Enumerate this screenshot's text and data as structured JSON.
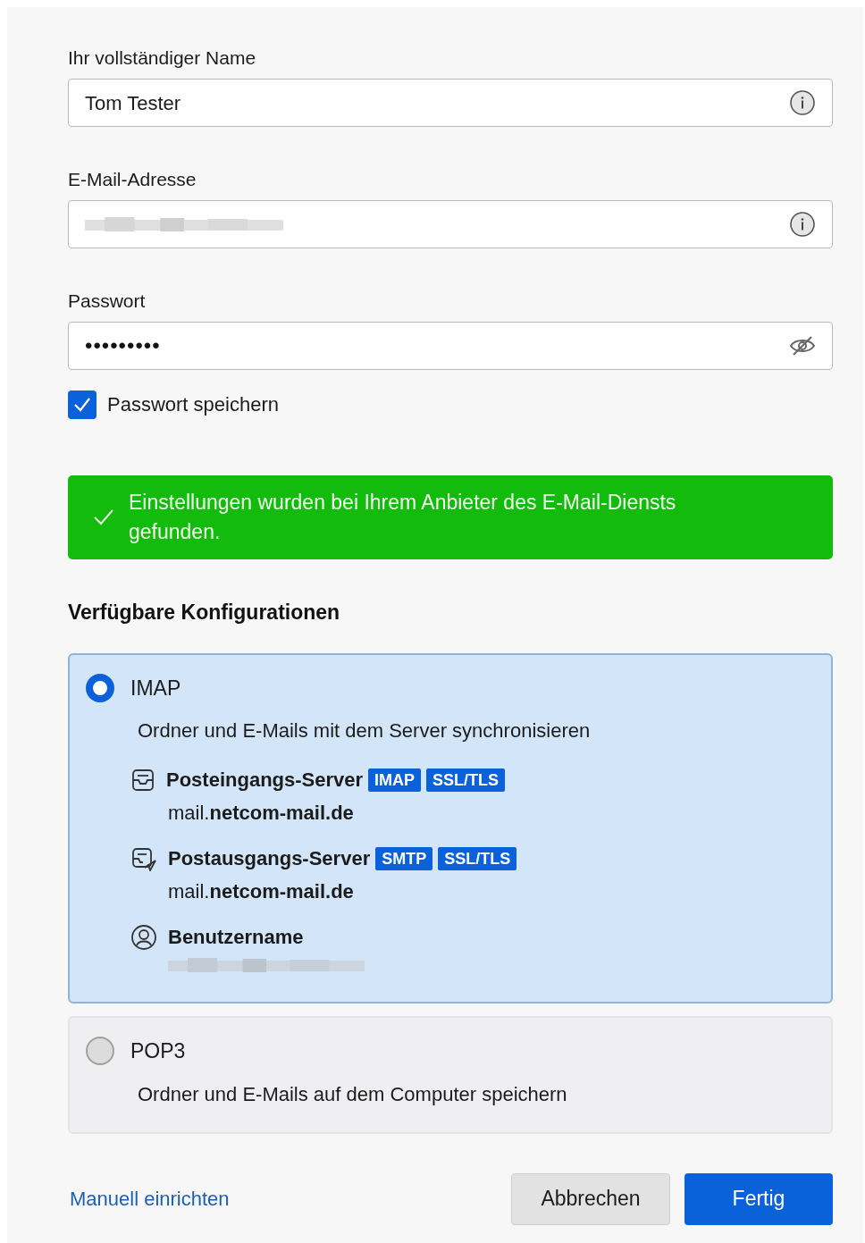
{
  "fields": [
    {
      "label": "Ihr vollständiger Name",
      "kind": "text",
      "value": "Tom Tester"
    },
    {
      "label": "E-Mail-Adresse",
      "kind": "text"
    },
    {
      "label": "Passwort",
      "kind": "password",
      "value": "•••••••••"
    }
  ],
  "remember_password": {
    "label": "Passwort speichern",
    "checked": true
  },
  "banner": {
    "text": "Einstellungen wurden bei Ihrem Anbieter des E-Mail-Diensts gefunden."
  },
  "configs_heading": "Verfügbare Konfigurationen",
  "configs": [
    {
      "name": "IMAP",
      "selected": true,
      "description": "Ordner und E-Mails mit dem Server synchronisieren",
      "details": [
        {
          "kind": "incoming",
          "label": "Posteingangs-Server",
          "tags": [
            "IMAP",
            "SSL/TLS"
          ],
          "value": "mail.**netcom-mail.de**"
        },
        {
          "kind": "outgoing",
          "label": "Postausgangs-Server",
          "tags": [
            "SMTP",
            "SSL/TLS"
          ],
          "value": "mail.**netcom-mail.de**"
        },
        {
          "kind": "username",
          "label": "Benutzername"
        }
      ]
    },
    {
      "name": "POP3",
      "selected": false,
      "description": "Ordner und E-Mails auf dem Computer speichern"
    }
  ],
  "manual_link": "Manuell einrichten",
  "buttons": [
    {
      "label": "Abbrechen",
      "kind": "secondary"
    },
    {
      "label": "Fertig",
      "kind": "primary"
    }
  ]
}
